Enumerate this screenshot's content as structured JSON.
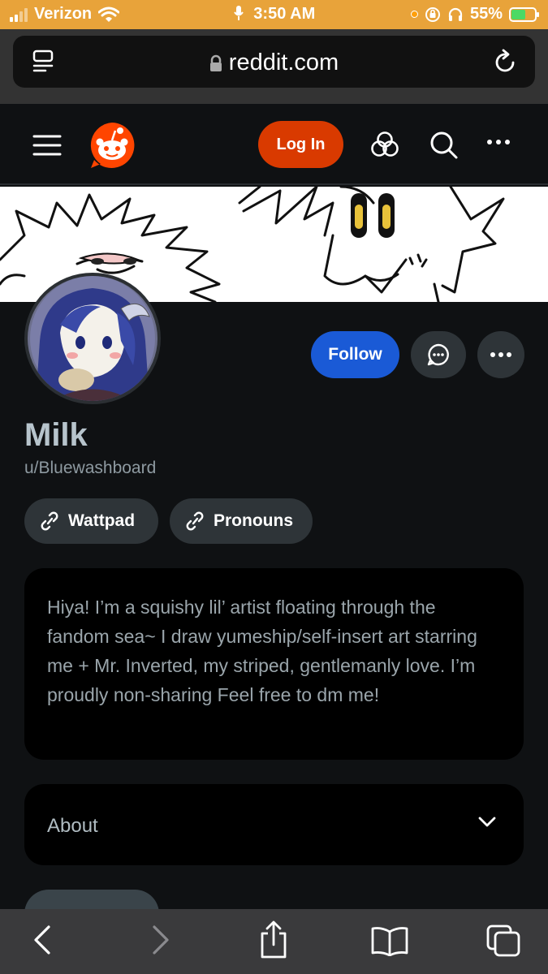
{
  "status_bar": {
    "carrier": "Verizon",
    "time": "3:50 AM",
    "battery_percent": "55%",
    "battery_level": 0.55,
    "accent_color": "#e8a33a"
  },
  "browser": {
    "url": "reddit.com",
    "icons": [
      "reader-icon",
      "lock-icon",
      "reload-icon"
    ]
  },
  "header": {
    "login_label": "Log In",
    "icons": [
      "hamburger-icon",
      "reddit-logo",
      "apps-icon",
      "search-icon",
      "more-icon"
    ],
    "brand_color": "#ff4500",
    "login_color": "#d93a00"
  },
  "profile": {
    "display_name": "Milk",
    "username": "u/Bluewashboard",
    "follow_label": "Follow",
    "follow_color": "#1a5ad6",
    "links": [
      {
        "label": "Wattpad",
        "icon": "link-icon"
      },
      {
        "label": "Pronouns",
        "icon": "link-icon"
      }
    ],
    "bio": "Hiya! I’m a squishy lil’ artist floating through the fandom sea~ I draw yumeship/self-insert art starring me + Mr. Inverted, my striped, gentlemanly love. I’m proudly non-sharing Feel free to dm me!",
    "about_label": "About"
  },
  "toolbar": {
    "icons": [
      "back-icon",
      "forward-icon",
      "share-icon",
      "bookmarks-icon",
      "tabs-icon"
    ]
  }
}
